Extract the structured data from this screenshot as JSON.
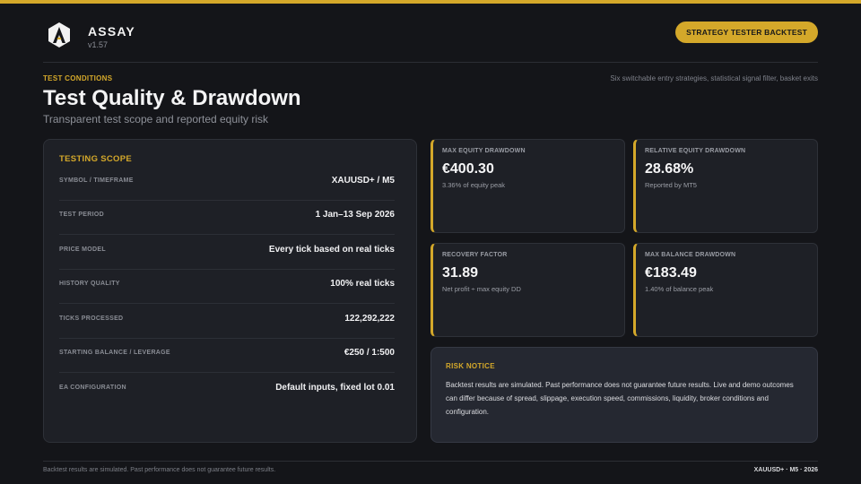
{
  "app": {
    "name": "ASSAY",
    "version": "v1.57",
    "badge": "STRATEGY TESTER BACKTEST",
    "accent": "#d4a82a",
    "logo_icon": "triangle-a-logo"
  },
  "section": {
    "eyebrow": "TEST CONDITIONS",
    "title": "Test Quality & Drawdown",
    "subtitle": "Transparent test scope and reported equity risk",
    "tagline": "Six switchable entry strategies, statistical signal filter, basket exits"
  },
  "scope": {
    "title": "TESTING SCOPE",
    "rows": [
      {
        "label": "SYMBOL / TIMEFRAME",
        "value": "XAUUSD+ / M5"
      },
      {
        "label": "TEST PERIOD",
        "value": "1 Jan–13 Sep 2026"
      },
      {
        "label": "PRICE MODEL",
        "value": "Every tick based on real ticks"
      },
      {
        "label": "HISTORY QUALITY",
        "value": "100% real ticks"
      },
      {
        "label": "TICKS PROCESSED",
        "value": "122,292,222"
      },
      {
        "label": "STARTING BALANCE / LEVERAGE",
        "value": "€250 / 1:500"
      },
      {
        "label": "EA CONFIGURATION",
        "value": "Default inputs, fixed lot 0.01"
      }
    ]
  },
  "metrics": [
    {
      "label": "MAX EQUITY DRAWDOWN",
      "value": "€400.30",
      "sub": "3.36% of equity peak"
    },
    {
      "label": "RELATIVE EQUITY DRAWDOWN",
      "value": "28.68%",
      "sub": "Reported by MT5"
    },
    {
      "label": "RECOVERY FACTOR",
      "value": "31.89",
      "sub": "Net profit ÷ max equity DD"
    },
    {
      "label": "MAX BALANCE DRAWDOWN",
      "value": "€183.49",
      "sub": "1.40% of balance peak"
    }
  ],
  "risk": {
    "title": "RISK NOTICE",
    "text": "Backtest results are simulated. Past performance does not guarantee future results. Live and demo outcomes can differ because of spread, slippage, execution speed, commissions, liquidity, broker conditions and configuration."
  },
  "footer": {
    "left": "Backtest results are simulated. Past performance does not guarantee future results.",
    "right": "XAUUSD+ · M5 · 2026"
  }
}
